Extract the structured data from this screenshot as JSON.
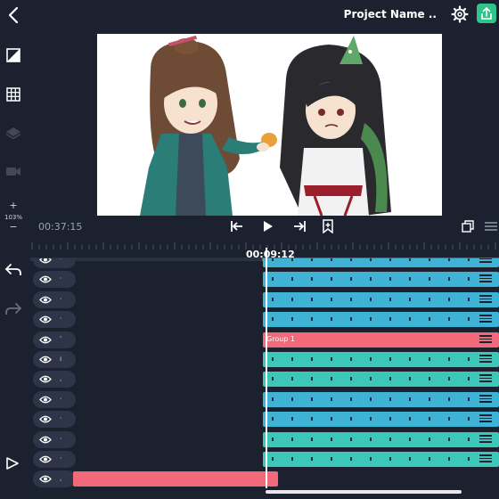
{
  "header": {
    "title": "Project Name ..",
    "accent": "#2ec48a"
  },
  "left_tools": [
    "frame-icon",
    "grid-icon",
    "layers-icon",
    "camera-icon"
  ],
  "zoom": {
    "plus": "+",
    "value": "103%",
    "minus": "−"
  },
  "playback": {
    "time": "00:37:15",
    "playhead_time": "00:09:12"
  },
  "tracks": [
    {
      "thumb": "·",
      "clip_label": "",
      "color": "#3fb3d6"
    },
    {
      "thumb": "·",
      "clip_label": "",
      "color": "#3fb3d6"
    },
    {
      "thumb": "·",
      "clip_label": "",
      "color": "#3fb3d6"
    },
    {
      "thumb": "·",
      "clip_label": "",
      "color": "#3fb3d6"
    },
    {
      "thumb": "ˈ",
      "clip_label": "Group 1",
      "color": "#f26a7a"
    },
    {
      "thumb": "ı",
      "clip_label": "",
      "color": "#3cc8b8"
    },
    {
      "thumb": "ˌ",
      "clip_label": "",
      "color": "#3cc8b8"
    },
    {
      "thumb": "·",
      "clip_label": "",
      "color": "#3fb3d6"
    },
    {
      "thumb": "·",
      "clip_label": "",
      "color": "#3fb3d6"
    },
    {
      "thumb": "·",
      "clip_label": "",
      "color": "#3cc8b8"
    },
    {
      "thumb": "·",
      "clip_label": "",
      "color": "#3cc8b8"
    },
    {
      "thumb": "ˌ",
      "clip_label": "",
      "color": "#f26a7a"
    }
  ]
}
